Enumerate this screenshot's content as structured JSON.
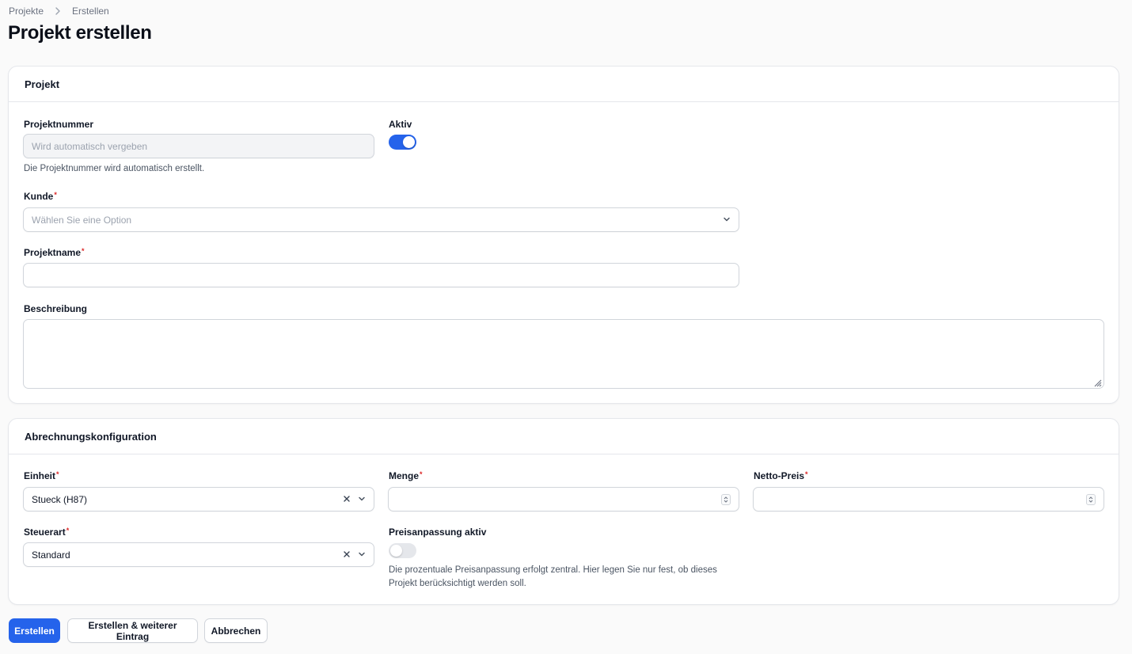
{
  "breadcrumb": {
    "items": [
      "Projekte",
      "Erstellen"
    ]
  },
  "page": {
    "title": "Projekt erstellen"
  },
  "projekt_section": {
    "title": "Projekt",
    "projektnummer": {
      "label": "Projektnummer",
      "placeholder": "Wird automatisch vergeben",
      "hint": "Die Projektnummer wird automatisch erstellt."
    },
    "aktiv": {
      "label": "Aktiv",
      "checked": true
    },
    "kunde": {
      "label": "Kunde",
      "required_marker": "*",
      "placeholder": "Wählen Sie eine Option"
    },
    "projektname": {
      "label": "Projektname",
      "required_marker": "*",
      "value": ""
    },
    "beschreibung": {
      "label": "Beschreibung",
      "value": ""
    }
  },
  "abrechnung_section": {
    "title": "Abrechnungskonfiguration",
    "einheit": {
      "label": "Einheit",
      "required_marker": "*",
      "value": "Stueck (H87)"
    },
    "menge": {
      "label": "Menge",
      "required_marker": "*",
      "value": ""
    },
    "netto_preis": {
      "label": "Netto-Preis",
      "required_marker": "*",
      "value": ""
    },
    "steuerart": {
      "label": "Steuerart",
      "required_marker": "*",
      "value": "Standard"
    },
    "preisanpassung": {
      "label": "Preisanpassung aktiv",
      "checked": false,
      "hint_line1": "Die prozentuale Preisanpassung erfolgt zentral. Hier legen Sie nur fest, ob dieses",
      "hint_line2": "Projekt berücksichtigt werden soll."
    }
  },
  "actions": {
    "create": "Erstellen",
    "create_another": "Erstellen & weiterer Eintrag",
    "cancel": "Abbrechen"
  },
  "colors": {
    "primary": "#2563eb",
    "required": "#dc2626",
    "border": "#d1d5db"
  },
  "icons": {
    "breadcrumb_separator": "chevron-right-icon",
    "select_arrow": "chevron-down-icon",
    "clear": "x-icon",
    "stepper": "stepper-icon"
  }
}
